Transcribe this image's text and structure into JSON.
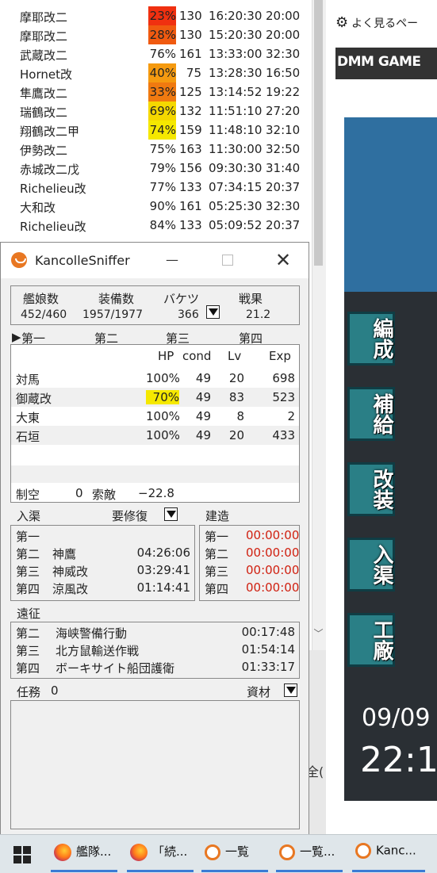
{
  "bg_list": {
    "rows": [
      {
        "name": "摩耶改二",
        "pct": "23%",
        "pct_color": "#f03010",
        "lv": "130",
        "t1": "16:20:30",
        "t2": "20:00"
      },
      {
        "name": "摩耶改二",
        "pct": "28%",
        "pct_color": "#f05a10",
        "lv": "130",
        "t1": "15:20:30",
        "t2": "20:00"
      },
      {
        "name": "武蔵改二",
        "pct": "76%",
        "pct_color": "",
        "lv": "161",
        "t1": "13:33:00",
        "t2": "32:30"
      },
      {
        "name": "Hornet改",
        "pct": "40%",
        "pct_color": "#f59a10",
        "lv": "75",
        "t1": "13:28:30",
        "t2": "16:50"
      },
      {
        "name": "隼鷹改二",
        "pct": "33%",
        "pct_color": "#f07a10",
        "lv": "125",
        "t1": "13:14:52",
        "t2": "19:22"
      },
      {
        "name": "瑞鶴改二",
        "pct": "69%",
        "pct_color": "#f5d800",
        "lv": "132",
        "t1": "11:51:10",
        "t2": "27:20"
      },
      {
        "name": "翔鶴改二甲",
        "pct": "74%",
        "pct_color": "#f5e800",
        "lv": "159",
        "t1": "11:48:10",
        "t2": "32:10"
      },
      {
        "name": "伊勢改二",
        "pct": "75%",
        "pct_color": "",
        "lv": "163",
        "t1": "11:30:00",
        "t2": "32:50"
      },
      {
        "name": "赤城改二戊",
        "pct": "79%",
        "pct_color": "",
        "lv": "156",
        "t1": "09:30:30",
        "t2": "31:40"
      },
      {
        "name": "Richelieu改",
        "pct": "77%",
        "pct_color": "",
        "lv": "133",
        "t1": "07:34:15",
        "t2": "20:37"
      },
      {
        "name": "大和改",
        "pct": "90%",
        "pct_color": "",
        "lv": "161",
        "t1": "05:25:30",
        "t2": "32:30"
      },
      {
        "name": "Richelieu改",
        "pct": "84%",
        "pct_color": "",
        "lv": "133",
        "t1": "05:09:52",
        "t2": "20:37"
      }
    ]
  },
  "browser": {
    "bookmark_label": "よく見るペー",
    "dmm_label": "DMM GAME",
    "game_buttons": [
      "編成",
      "補給",
      "改装",
      "入渠",
      "工廠"
    ],
    "game_date": "09/09",
    "game_time": "22:1",
    "side_fragment": "全("
  },
  "sniffer": {
    "title": "KancolleSniffer",
    "min_glyph": "—",
    "close_glyph": "✕",
    "summary": {
      "labels": [
        "艦娘数",
        "装備数",
        "バケツ",
        "戦果"
      ],
      "values": [
        "452/460",
        "1957/1977",
        "366",
        "21.2"
      ]
    },
    "fleet_tabs": [
      "第一",
      "第二",
      "第三",
      "第四"
    ],
    "fleet_headers": [
      "HP",
      "cond",
      "Lv",
      "Exp"
    ],
    "ships": [
      {
        "name": "対馬",
        "hp": "100%",
        "hp_color": "",
        "cond": "49",
        "lv": "20",
        "exp": "698"
      },
      {
        "name": "御蔵改",
        "hp": "70%",
        "hp_color": "#f5e800",
        "cond": "49",
        "lv": "83",
        "exp": "523"
      },
      {
        "name": "大東",
        "hp": "100%",
        "hp_color": "",
        "cond": "49",
        "lv": "8",
        "exp": "2"
      },
      {
        "name": "石垣",
        "hp": "100%",
        "hp_color": "",
        "cond": "49",
        "lv": "20",
        "exp": "433"
      }
    ],
    "air": {
      "label": "制空",
      "value": "0",
      "search_label": "索敵",
      "search_value": "−22.8"
    },
    "docks": {
      "label": "入渠",
      "repair_label": "要修復",
      "rows": [
        {
          "fleet": "第一",
          "ship": "",
          "time": ""
        },
        {
          "fleet": "第二",
          "ship": "神鷹",
          "time": "04:26:06"
        },
        {
          "fleet": "第三",
          "ship": "神威改",
          "time": "03:29:41"
        },
        {
          "fleet": "第四",
          "ship": "涼風改",
          "time": "01:14:41"
        }
      ]
    },
    "build": {
      "label": "建造",
      "rows": [
        {
          "slot": "第一",
          "time": "00:00:00"
        },
        {
          "slot": "第二",
          "time": "00:00:00"
        },
        {
          "slot": "第三",
          "time": "00:00:00"
        },
        {
          "slot": "第四",
          "time": "00:00:00"
        }
      ]
    },
    "expedition": {
      "label": "遠征",
      "rows": [
        {
          "fleet": "第二",
          "name": "海峡警備行動",
          "time": "00:17:48"
        },
        {
          "fleet": "第三",
          "name": "北方鼠輸送作戦",
          "time": "01:54:14"
        },
        {
          "fleet": "第四",
          "name": "ボーキサイト船団護衛",
          "time": "01:33:17"
        }
      ]
    },
    "quests": {
      "label": "任務",
      "count": "0",
      "materials_label": "資材"
    }
  },
  "taskbar": {
    "items": [
      {
        "label": "艦隊...",
        "icon": "firefox-icon"
      },
      {
        "label": "「続...",
        "icon": "firefox-icon"
      },
      {
        "label": "一覧",
        "icon": "kancolle-sniffer-icon"
      },
      {
        "label": "一覧...",
        "icon": "kancolle-sniffer-icon"
      },
      {
        "label": "Kanc...",
        "icon": "kancolle-sniffer-icon"
      }
    ]
  },
  "colors": {
    "accent_red": "#d02010",
    "highlight_yellow": "#f5e800",
    "title_icon": "#e87722"
  }
}
